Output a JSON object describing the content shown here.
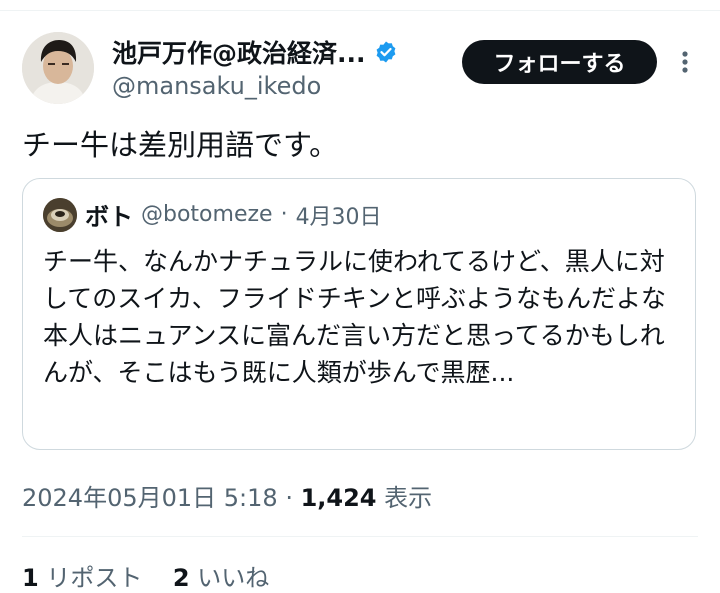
{
  "author": {
    "display_name": "池戸万作@政治経済...",
    "handle": "@mansaku_ikedo",
    "verified": true
  },
  "follow_button_label": "フォローする",
  "more_icon": "more-vertical-icon",
  "tweet_text": "チー牛は差別用語です。",
  "quote": {
    "name": "ボト",
    "handle": "@botomeze",
    "date": "4月30日",
    "text": "チー牛、なんかナチュラルに使われてるけど、黒人に対してのスイカ、フライドチキンと呼ぶようなもんだよな\n本人はニュアンスに富んだ言い方だと思ってるかもしれんが、そこはもう既に人類が歩んで黒歴..."
  },
  "meta": {
    "timestamp": "2024年05月01日 5:18",
    "views_count": "1,424",
    "views_label": "表示"
  },
  "stats": {
    "reposts_count": "1",
    "reposts_label": "リポスト",
    "likes_count": "2",
    "likes_label": "いいね"
  },
  "colors": {
    "text": "#0f1419",
    "secondary": "#536471",
    "verified_blue": "#1d9bf0",
    "border": "#cfd9de"
  }
}
